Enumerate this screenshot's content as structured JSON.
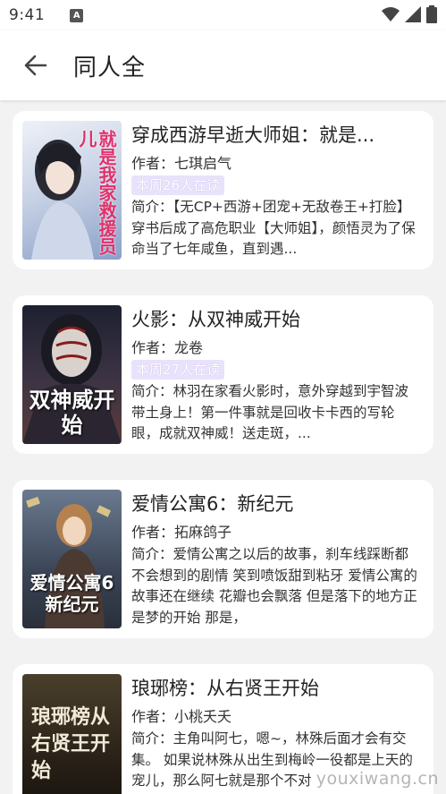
{
  "status": {
    "time": "9:41",
    "a_icon": "A"
  },
  "header": {
    "title": "同人全"
  },
  "books": [
    {
      "title": "穿成西游早逝大师姐：就是...",
      "author": "作者：七琪启气",
      "badge": "本周26人在读",
      "intro": "简介：【无CP+西游+团宠+无敌卷王+打脸】 穿书后成了高危职业【大师姐】，颜悟灵为了保命当了七年咸鱼，直到遇...",
      "cover_text": "就是我家救援员儿",
      "cover_colors": [
        "#dfe6f0",
        "#8aa0c8"
      ]
    },
    {
      "title": "火影：从双神威开始",
      "author": "作者：龙卷",
      "badge": "本周27人在读",
      "intro": "简介：林羽在家看火影时，意外穿越到宇智波带土身上！第一件事就是回收卡卡西的写轮眼，成就双神威！送走斑，...",
      "cover_text": "双神威开始",
      "cover_colors": [
        "#2b2d3a",
        "#6b4a4a"
      ]
    },
    {
      "title": "爱情公寓6：新纪元",
      "author": "作者：拓麻鸽子",
      "badge": "",
      "intro": "简介：爱情公寓之以后的故事，刹车线踩断都不会想到的剧情 笑到喷饭甜到粘牙 爱情公寓的故事还在继续 花瓣也会飘落 但是落下的地方正是梦的开始 那是，",
      "cover_text": "爱情公寓6新纪元",
      "cover_colors": [
        "#3a4456",
        "#b08a6a"
      ]
    },
    {
      "title": "琅琊榜：从右贤王开始",
      "author": "作者：小桃夭夭",
      "badge": "",
      "intro": "简介：主角叫阿七，嗯~，林殊后面才会有交集。 如果说林殊从出生到梅岭一役都是上天的宠儿，那么阿七就是那个不对",
      "cover_text": "琅琊榜从右贤王开始",
      "cover_colors": [
        "#3d3325",
        "#1a1510"
      ]
    }
  ],
  "watermark": "youxiwang.cn"
}
